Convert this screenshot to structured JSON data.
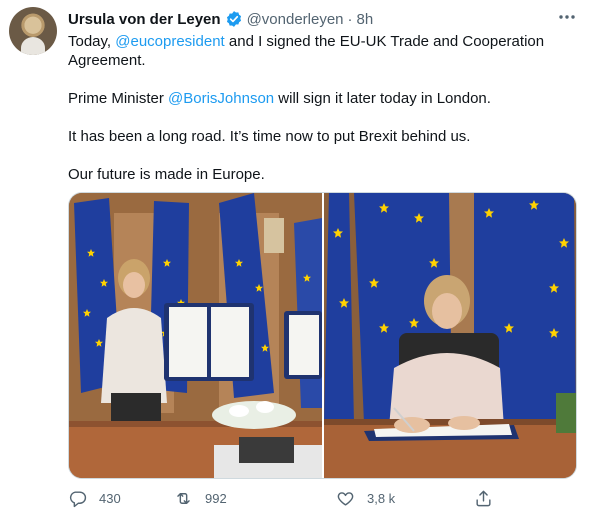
{
  "tweet": {
    "author_name": "Ursula von der Leyen",
    "author_handle": "@vonderleyen",
    "separator": "·",
    "time": "8h",
    "paragraphs": [
      {
        "before": "Today, ",
        "mention": "@eucopresident",
        "after": " and I signed the EU-UK Trade and Cooperation Agreement."
      },
      {
        "before": "Prime Minister ",
        "mention": "@BorisJohnson",
        "after": " will sign it later today in London."
      },
      {
        "text": "It has been a long road. It’s time now to put Brexit behind us."
      },
      {
        "text": "Our future is made in Europe."
      }
    ]
  },
  "actions": {
    "reply_count": "430",
    "retweet_count": "992",
    "like_count": "3,8 k"
  },
  "icons": {
    "verified": "verified-badge-icon",
    "more": "more-options-icon",
    "reply": "reply-icon",
    "retweet": "retweet-icon",
    "like": "like-icon",
    "share": "share-icon"
  },
  "colors": {
    "accent": "#1d9bf0",
    "text": "#0f1419",
    "secondary": "#536471",
    "eu_blue": "#1f3e9e",
    "eu_gold": "#ffd200"
  }
}
